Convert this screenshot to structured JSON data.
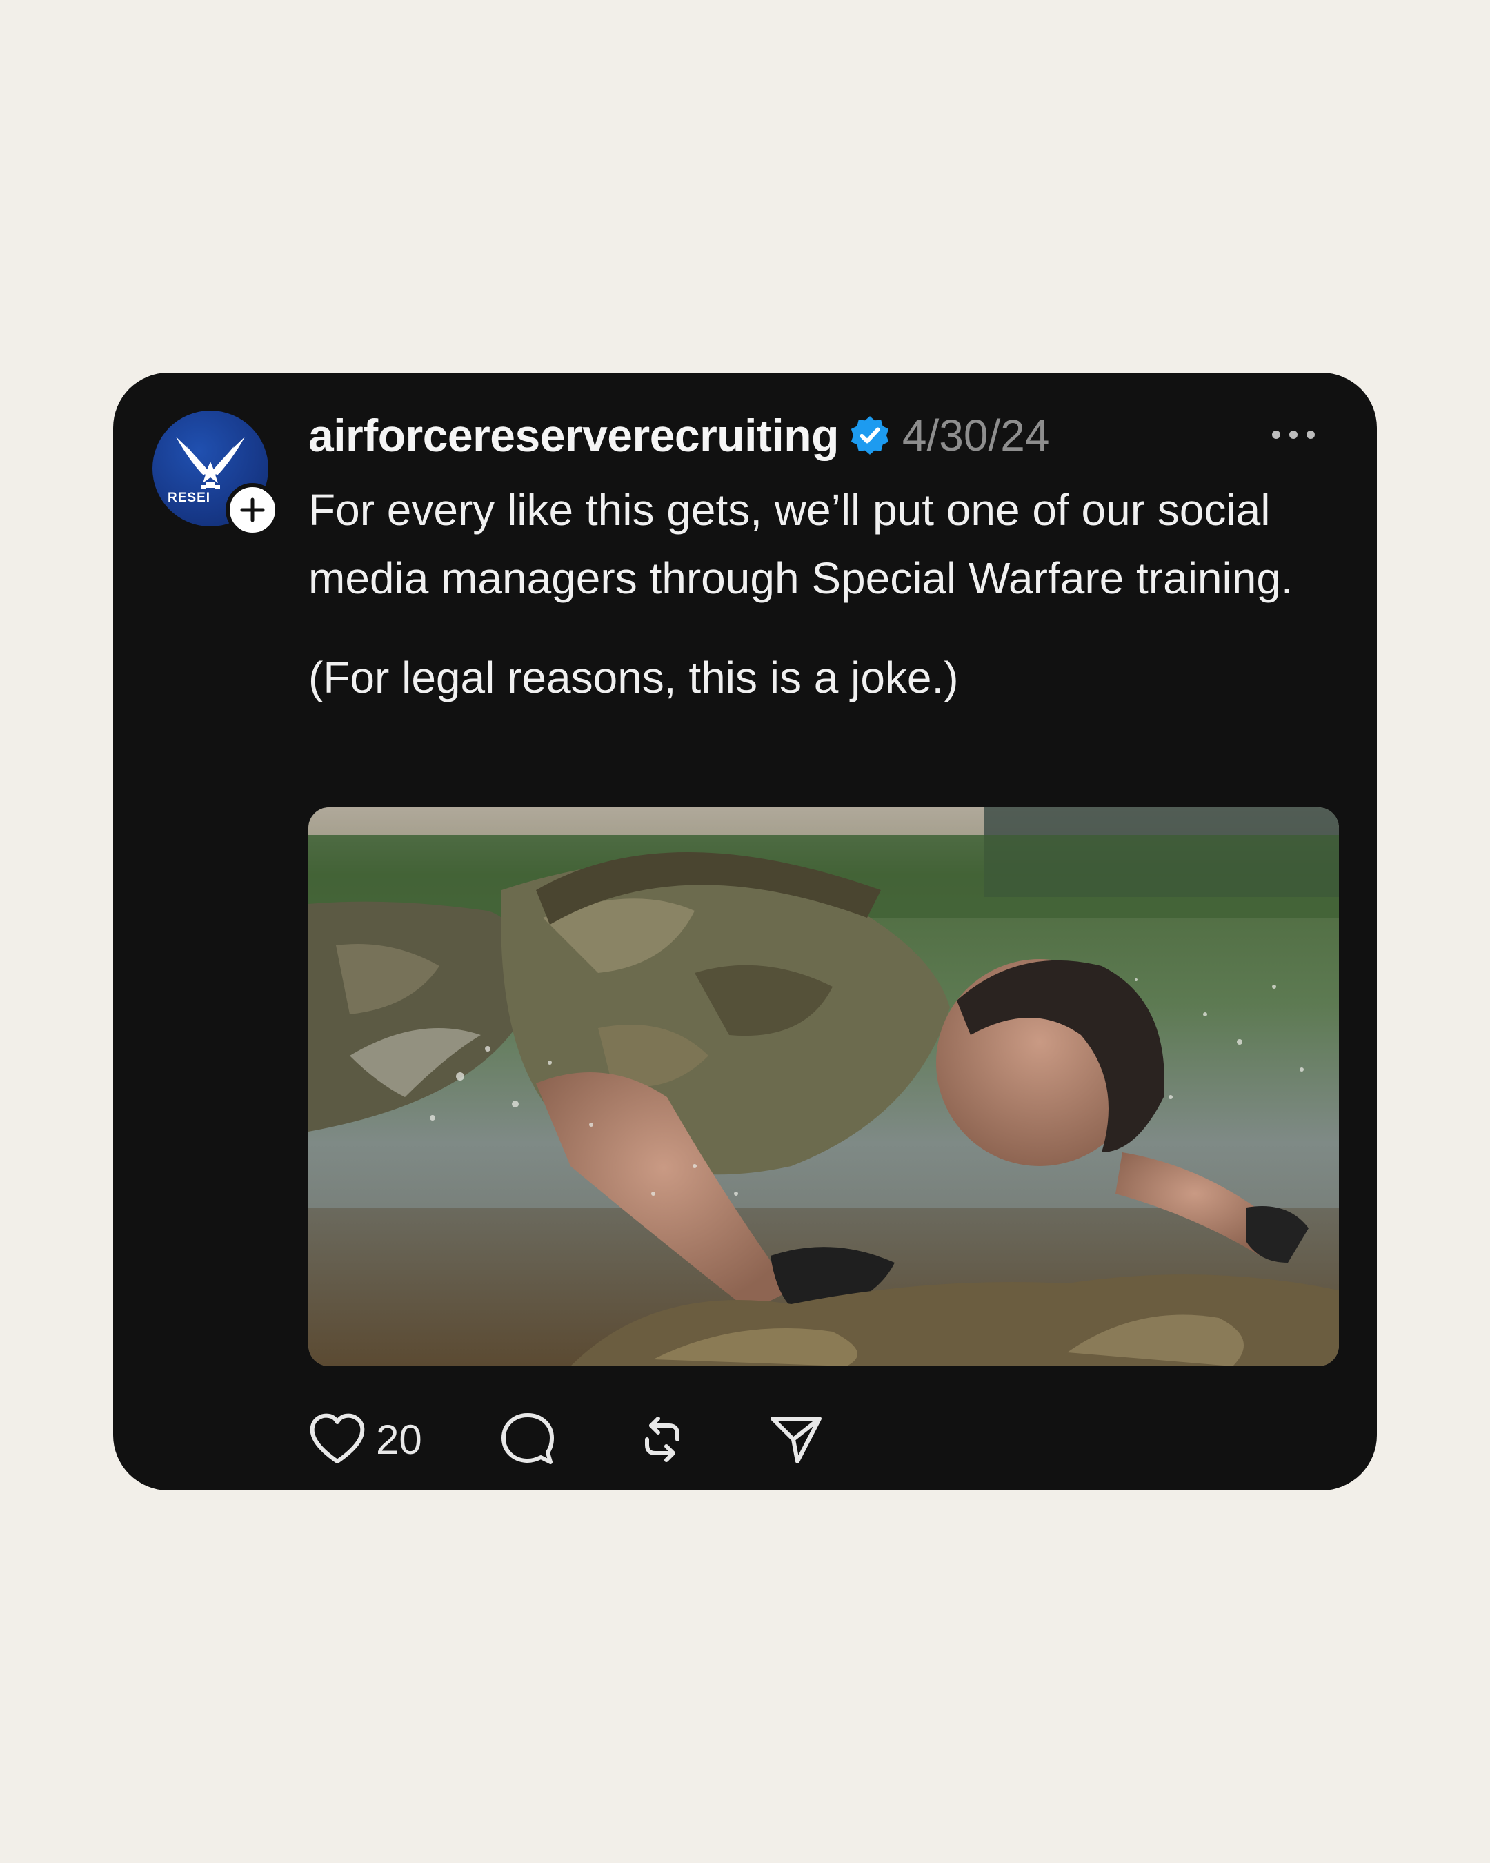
{
  "post": {
    "username": "airforcereserverecruiting",
    "verified": true,
    "date": "4/30/24",
    "avatar_text": "RESEI",
    "text_paragraphs": [
      "For every like this gets, we’ll put one of our social media managers through Special Warfare training.",
      "(For legal reasons, this is a joke.)"
    ],
    "image_description": "Soldier in camouflage uniform crawling through mud and water",
    "actions": {
      "like_count": "20",
      "like_icon": "heart-icon",
      "comment_icon": "comment-bubble-icon",
      "repost_icon": "repost-icon",
      "share_icon": "send-icon"
    }
  },
  "colors": {
    "background": "#f2efe9",
    "card": "#111111",
    "verified_badge": "#1d9bf0",
    "date_gray": "#8e8e8e"
  }
}
